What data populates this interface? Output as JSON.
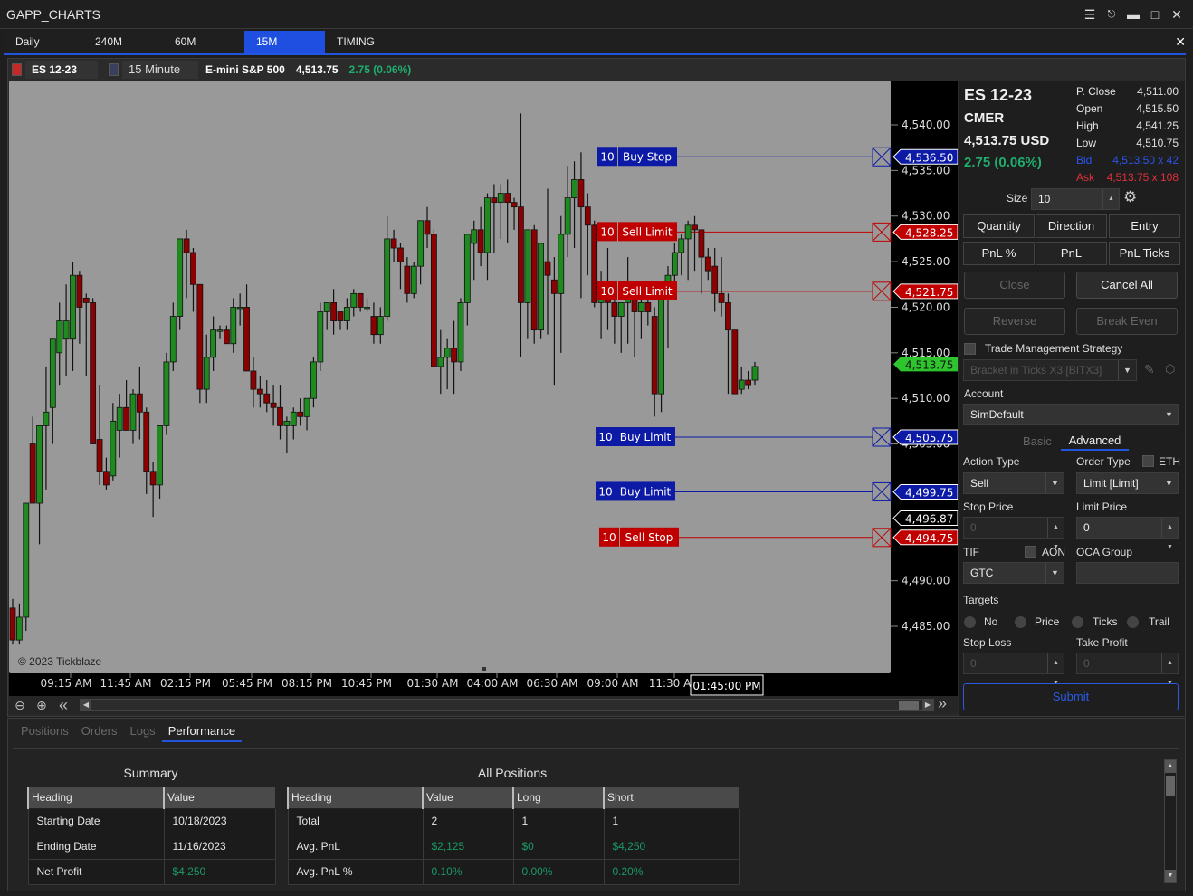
{
  "window": {
    "title": "GAPP_CHARTS",
    "controls": [
      "menu-icon",
      "pin-icon",
      "minimize-icon",
      "maximize-icon",
      "close-icon"
    ]
  },
  "tabs": [
    {
      "label": "Daily",
      "active": false
    },
    {
      "label": "240M",
      "active": false
    },
    {
      "label": "60M",
      "active": false
    },
    {
      "label": "15M",
      "active": true
    },
    {
      "label": "TIMING",
      "active": false
    }
  ],
  "symbol_bar": {
    "symbol": "ES 12-23",
    "symbol_color": "#c62828",
    "timeframe": "15 Minute",
    "timeframe_color": "#3a3f5c",
    "name": "E-mini S&P 500",
    "price": "4,513.75",
    "change": "2.75 (0.06%)"
  },
  "chart": {
    "copyright": "© 2023 Tickblaze",
    "crosshair_time": "01:45:00 PM",
    "colors": {
      "up": "#1f8a1f",
      "down": "#8b0000",
      "background": "#999999",
      "buy": "#0c1aa6",
      "sell": "#c00000",
      "last": "#2ec42e"
    }
  },
  "chart_data": {
    "type": "candlestick",
    "title": "ES 12-23 15 Minute",
    "ylim": [
      4482.5,
      4544.5
    ],
    "y_ticks": [
      "4,540.00",
      "4,535.00",
      "4,530.00",
      "4,525.00",
      "4,520.00",
      "4,515.00",
      "4,510.00",
      "4,505.00",
      "4,490.00",
      "4,485.00"
    ],
    "y_tick_values": [
      4540,
      4535,
      4530,
      4525,
      4520,
      4515,
      4510,
      4505,
      4490,
      4485
    ],
    "x_ticks": [
      "09:15 AM",
      "11:45 AM",
      "02:15 PM",
      "05:45 PM",
      "08:15 PM",
      "10:45 PM",
      "01:30 AM",
      "04:00 AM",
      "06:30 AM",
      "09:00 AM",
      "11:30 A"
    ],
    "last_price": {
      "value": 4513.75,
      "label": "4,513.75"
    },
    "crosshair_price": {
      "value": 4496.87,
      "label": "4,496.87"
    },
    "orders": [
      {
        "qty": "10",
        "label": "Buy Stop",
        "price": 4536.5,
        "price_label": "4,536.50",
        "side": "buy"
      },
      {
        "qty": "10",
        "label": "Sell Limit",
        "price": 4528.25,
        "price_label": "4,528.25",
        "side": "sell"
      },
      {
        "qty": "10",
        "label": "Sell Limit",
        "price": 4521.75,
        "price_label": "4,521.75",
        "side": "sell"
      },
      {
        "qty": "10",
        "label": "Buy Limit",
        "price": 4505.75,
        "price_label": "4,505.75",
        "side": "buy"
      },
      {
        "qty": "10",
        "label": "Buy Limit",
        "price": 4499.75,
        "price_label": "4,499.75",
        "side": "buy"
      },
      {
        "qty": "10",
        "label": "Sell Stop",
        "price": 4494.75,
        "price_label": "4,494.75",
        "side": "sell"
      }
    ],
    "candles": [
      [
        4487.0,
        4488.0,
        4483.0,
        4483.5
      ],
      [
        4483.5,
        4487.5,
        4483.0,
        4486.0
      ],
      [
        4486.0,
        4498.5,
        4484.5,
        4498.5
      ],
      [
        4505.0,
        4508.0,
        4501.5,
        4498.5
      ],
      [
        4498.5,
        4506.5,
        4494.0,
        4507.0
      ],
      [
        4507.0,
        4513.5,
        4500.0,
        4508.5
      ],
      [
        4509.0,
        4515.5,
        4505.0,
        4516.5
      ],
      [
        4515.0,
        4520.5,
        4511.5,
        4518.5
      ],
      [
        4516.5,
        4522.5,
        4512.5,
        4518.5
      ],
      [
        4516.5,
        4525.0,
        4513.0,
        4523.5
      ],
      [
        4523.5,
        4524.0,
        4516.0,
        4520.0
      ],
      [
        4521.0,
        4521.5,
        4512.5,
        4520.5
      ],
      [
        4520.5,
        4521.0,
        4508.0,
        4505.0
      ],
      [
        4505.5,
        4511.5,
        4500.5,
        4502.0
      ],
      [
        4502.0,
        4503.5,
        4500.0,
        4500.5
      ],
      [
        4501.5,
        4509.5,
        4501.0,
        4507.5
      ],
      [
        4506.5,
        4510.5,
        4503.5,
        4509.0
      ],
      [
        4509.0,
        4512.0,
        4506.5,
        4506.5
      ],
      [
        4506.5,
        4511.0,
        4505.0,
        4510.5
      ],
      [
        4510.5,
        4513.5,
        4505.5,
        4508.5
      ],
      [
        4508.5,
        4509.0,
        4499.5,
        4502.0
      ],
      [
        4502.0,
        4503.0,
        4497.0,
        4500.5
      ],
      [
        4500.5,
        4507.0,
        4499.0,
        4507.0
      ],
      [
        4507.0,
        4515.0,
        4506.0,
        4514.0
      ],
      [
        4514.0,
        4520.5,
        4513.0,
        4519.0
      ],
      [
        4519.0,
        4526.5,
        4517.5,
        4527.5
      ],
      [
        4527.5,
        4528.5,
        4521.0,
        4526.0
      ],
      [
        4526.0,
        4526.5,
        4519.5,
        4522.5
      ],
      [
        4522.5,
        4522.5,
        4509.5,
        4511.0
      ],
      [
        4511.0,
        4517.0,
        4509.5,
        4514.5
      ],
      [
        4514.5,
        4519.0,
        4513.0,
        4517.5
      ],
      [
        4517.5,
        4518.0,
        4516.5,
        4517.5
      ],
      [
        4517.5,
        4518.0,
        4516.0,
        4516.0
      ],
      [
        4516.0,
        4521.0,
        4515.0,
        4520.0
      ],
      [
        4520.0,
        4521.5,
        4518.0,
        4520.0
      ],
      [
        4520.0,
        4522.5,
        4514.5,
        4513.0
      ],
      [
        4513.0,
        4514.5,
        4509.0,
        4511.0
      ],
      [
        4511.0,
        4512.5,
        4509.0,
        4510.5
      ],
      [
        4510.5,
        4512.0,
        4508.5,
        4509.5
      ],
      [
        4509.5,
        4511.5,
        4507.0,
        4509.0
      ],
      [
        4509.0,
        4511.5,
        4505.5,
        4507.0
      ],
      [
        4507.0,
        4508.0,
        4504.0,
        4507.5
      ],
      [
        4507.0,
        4509.0,
        4505.5,
        4508.5
      ],
      [
        4508.5,
        4510.0,
        4507.0,
        4508.0
      ],
      [
        4508.0,
        4510.0,
        4506.5,
        4510.0
      ],
      [
        4510.0,
        4514.5,
        4509.0,
        4514.0
      ],
      [
        4514.0,
        4520.5,
        4513.0,
        4519.5
      ],
      [
        4519.5,
        4520.5,
        4517.5,
        4520.5
      ],
      [
        4520.5,
        4522.0,
        4517.0,
        4518.5
      ],
      [
        4519.5,
        4519.5,
        4517.5,
        4518.5
      ],
      [
        4518.5,
        4521.0,
        4517.5,
        4520.0
      ],
      [
        4520.0,
        4522.0,
        4519.0,
        4521.5
      ],
      [
        4521.5,
        4521.5,
        4519.5,
        4520.0
      ],
      [
        4520.0,
        4521.0,
        4519.5,
        4520.0
      ],
      [
        4519.0,
        4520.5,
        4516.0,
        4517.0
      ],
      [
        4517.0,
        4520.0,
        4516.0,
        4519.0
      ],
      [
        4519.0,
        4530.0,
        4518.5,
        4527.5
      ],
      [
        4527.5,
        4528.5,
        4525.0,
        4526.5
      ],
      [
        4526.5,
        4527.0,
        4522.0,
        4525.0
      ],
      [
        4524.5,
        4525.5,
        4520.5,
        4521.5
      ],
      [
        4521.5,
        4525.0,
        4521.0,
        4524.5
      ],
      [
        4524.5,
        4529.0,
        4522.5,
        4529.5
      ],
      [
        4529.5,
        4531.0,
        4526.5,
        4528.0
      ],
      [
        4528.0,
        4528.5,
        4517.5,
        4513.5
      ],
      [
        4513.5,
        4517.5,
        4510.5,
        4514.5
      ],
      [
        4514.5,
        4516.5,
        4511.0,
        4515.5
      ],
      [
        4515.5,
        4518.5,
        4510.5,
        4514.0
      ],
      [
        4514.0,
        4521.0,
        4513.0,
        4520.5
      ],
      [
        4520.5,
        4526.5,
        4518.0,
        4528.0
      ],
      [
        4527.0,
        4529.5,
        4523.0,
        4528.5
      ],
      [
        4528.5,
        4531.0,
        4524.5,
        4526.0
      ],
      [
        4526.0,
        4532.5,
        4523.0,
        4532.0
      ],
      [
        4532.0,
        4533.5,
        4526.0,
        4531.5
      ],
      [
        4531.5,
        4533.5,
        4527.5,
        4532.5
      ],
      [
        4532.5,
        4534.0,
        4527.0,
        4531.5
      ],
      [
        4531.5,
        4532.0,
        4528.5,
        4531.0
      ],
      [
        4531.0,
        4541.25,
        4514.5,
        4520.5
      ],
      [
        4520.5,
        4528.0,
        4516.5,
        4528.5
      ],
      [
        4528.5,
        4529.0,
        4516.0,
        4517.5
      ],
      [
        4517.5,
        4525.0,
        4516.5,
        4527.0
      ],
      [
        4525.0,
        4533.0,
        4517.0,
        4523.5
      ],
      [
        4523.0,
        4525.5,
        4511.5,
        4521.5
      ],
      [
        4521.5,
        4530.0,
        4515.0,
        4528.0
      ],
      [
        4528.0,
        4535.5,
        4525.5,
        4532.0
      ],
      [
        4532.0,
        4536.0,
        4526.5,
        4534.0
      ],
      [
        4534.0,
        4537.0,
        4521.0,
        4531.0
      ],
      [
        4531.0,
        4532.5,
        4523.5,
        4529.0
      ],
      [
        4529.0,
        4529.5,
        4520.0,
        4520.5
      ],
      [
        4520.5,
        4524.0,
        4516.5,
        4522.5
      ],
      [
        4522.5,
        4526.5,
        4517.5,
        4520.5
      ],
      [
        4520.5,
        4521.0,
        4516.0,
        4519.0
      ],
      [
        4519.0,
        4520.5,
        4515.0,
        4520.5
      ],
      [
        4520.5,
        4525.5,
        4516.0,
        4522.0
      ],
      [
        4521.5,
        4522.0,
        4514.5,
        4519.5
      ],
      [
        4519.5,
        4522.5,
        4516.5,
        4520.5
      ],
      [
        4520.5,
        4521.0,
        4518.0,
        4519.5
      ],
      [
        4519.0,
        4520.0,
        4508.0,
        4510.5
      ],
      [
        4510.5,
        4522.0,
        4508.5,
        4522.0
      ],
      [
        4522.0,
        4524.5,
        4515.5,
        4523.5
      ],
      [
        4523.5,
        4527.0,
        4521.5,
        4526.0
      ],
      [
        4526.0,
        4528.0,
        4523.5,
        4527.5
      ],
      [
        4527.5,
        4529.5,
        4523.0,
        4529.0
      ],
      [
        4529.0,
        4530.0,
        4524.0,
        4528.5
      ],
      [
        4528.5,
        4528.5,
        4521.5,
        4525.5
      ],
      [
        4525.5,
        4526.5,
        4523.0,
        4524.0
      ],
      [
        4524.5,
        4526.5,
        4519.5,
        4521.5
      ],
      [
        4521.5,
        4525.5,
        4519.0,
        4520.5
      ],
      [
        4520.5,
        4521.5,
        4510.5,
        4517.5
      ],
      [
        4517.5,
        4517.0,
        4510.5,
        4510.5
      ],
      [
        4511.0,
        4513.5,
        4510.5,
        4512.0
      ],
      [
        4512.0,
        4513.0,
        4511.0,
        4511.5
      ],
      [
        4512.0,
        4514.0,
        4511.5,
        4513.5
      ]
    ]
  },
  "order_panel": {
    "symbol": "ES 12-23",
    "exchange": "CMER",
    "price": "4,513.75 USD",
    "change": "2.75 (0.06%)",
    "stats": [
      {
        "label": "P. Close",
        "value": "4,511.00",
        "color": "#e0e0e0"
      },
      {
        "label": "Open",
        "value": "4,515.50",
        "color": "#e0e0e0"
      },
      {
        "label": "High",
        "value": "4,541.25",
        "color": "#e0e0e0"
      },
      {
        "label": "Low",
        "value": "4,510.75",
        "color": "#e0e0e0"
      },
      {
        "label": "Bid",
        "value": "4,513.50 x 42",
        "color": "#2a55ee"
      },
      {
        "label": "Ask",
        "value": "4,513.75 x 108",
        "color": "#e0303a"
      }
    ],
    "size_label": "Size",
    "size_value": "10",
    "grid_buttons": [
      "Quantity",
      "Direction",
      "Entry",
      "PnL %",
      "PnL",
      "PnL Ticks"
    ],
    "close_label": "Close",
    "cancel_all_label": "Cancel All",
    "reverse_label": "Reverse",
    "break_even_label": "Break Even",
    "tms_label": "Trade Management Strategy",
    "tms_value": "Bracket in Ticks X3 [BITX3]",
    "account_label": "Account",
    "account_value": "SimDefault",
    "mode_tabs": [
      {
        "label": "Basic",
        "active": false
      },
      {
        "label": "Advanced",
        "active": true
      }
    ],
    "action_type_label": "Action Type",
    "action_type_value": "Sell",
    "order_type_label": "Order Type",
    "order_type_value": "Limit [Limit]",
    "eth_label": "ETH",
    "stop_price_label": "Stop Price",
    "stop_price_value": "0",
    "limit_price_label": "Limit Price",
    "limit_price_value": "0",
    "tif_label": "TIF",
    "tif_value": "GTC",
    "aon_label": "AON",
    "oca_label": "OCA Group",
    "oca_value": "",
    "targets_label": "Targets",
    "targets_options": [
      "No",
      "Price",
      "Ticks",
      "Trail"
    ],
    "stop_loss_label": "Stop Loss",
    "stop_loss_value": "0",
    "take_profit_label": "Take Profit",
    "take_profit_value": "0",
    "submit_label": "Submit"
  },
  "bottom": {
    "tabs": [
      {
        "label": "Positions",
        "active": false
      },
      {
        "label": "Orders",
        "active": false
      },
      {
        "label": "Logs",
        "active": false
      },
      {
        "label": "Performance",
        "active": true
      }
    ],
    "summary": {
      "title": "Summary",
      "headers": [
        "Heading",
        "Value"
      ],
      "rows": [
        {
          "cells": [
            "Starting Date",
            "10/18/2023"
          ],
          "green": [
            false,
            false
          ]
        },
        {
          "cells": [
            "Ending Date",
            "11/16/2023"
          ],
          "green": [
            false,
            false
          ]
        },
        {
          "cells": [
            "Net Profit",
            "$4,250"
          ],
          "green": [
            false,
            true
          ]
        }
      ]
    },
    "all_positions": {
      "title": "All Positions",
      "headers": [
        "Heading",
        "Value",
        "Long",
        "Short"
      ],
      "rows": [
        {
          "cells": [
            "Total",
            "2",
            "1",
            "1"
          ],
          "green": [
            false,
            false,
            false,
            false
          ]
        },
        {
          "cells": [
            "Avg. PnL",
            "$2,125",
            "$0",
            "$4,250"
          ],
          "green": [
            false,
            true,
            true,
            true
          ]
        },
        {
          "cells": [
            "Avg. PnL %",
            "0.10%",
            "0.00%",
            "0.20%"
          ],
          "green": [
            false,
            true,
            true,
            true
          ]
        }
      ]
    }
  }
}
